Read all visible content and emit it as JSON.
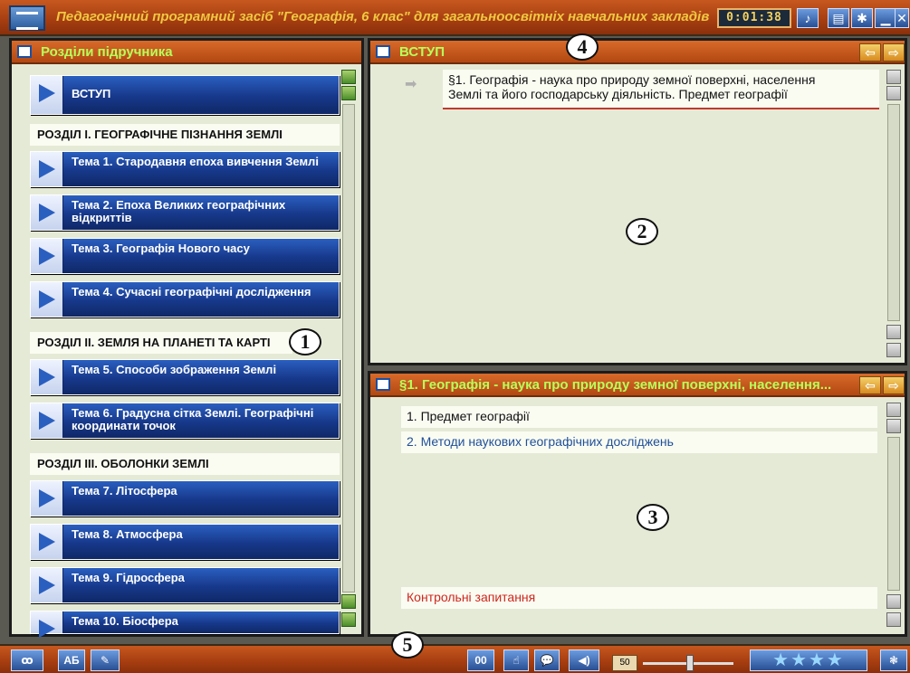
{
  "window": {
    "title": "Педагогічний програмний засіб \"Географія, 6 клас\" для загальноосвітніх навчальних закладів",
    "timer": "0:01:38"
  },
  "left_panel": {
    "title": "Розділи підручника",
    "intro_button": "ВСТУП",
    "section1": "РОЗДІЛ І. ГЕОГРАФІЧНЕ ПІЗНАННЯ ЗЕМЛІ",
    "topics1": [
      "Тема 1. Стародавня епоха вивчення Землі",
      "Тема 2. Епоха Великих географічних відкриттів",
      "Тема 3. Географія Нового часу",
      "Тема 4. Сучасні географічні дослідження"
    ],
    "section2": "РОЗДІЛ ІІ. ЗЕМЛЯ НА ПЛАНЕТІ ТА КАРТІ",
    "topics2": [
      "Тема 5. Способи зображення Землі",
      "Тема 6. Градусна сітка Землі. Географічні координати точок"
    ],
    "section3": "РОЗДІЛ ІІІ. ОБОЛОНКИ ЗЕМЛІ",
    "topics3": [
      "Тема 7. Літосфера",
      "Тема 8. Атмосфера",
      "Тема 9. Гідросфера",
      "Тема 10. Біосфера"
    ]
  },
  "top_right_panel": {
    "title": "ВСТУП",
    "paragraph_line1": "§1. Географія - наука про природу земної поверхні, населення",
    "paragraph_line2": "Землі та його господарську діяльність. Предмет географії"
  },
  "bottom_right_panel": {
    "title": "§1. Географія - наука про природу земної поверхні, населення...",
    "items": [
      "1. Предмет географії",
      "2. Методи наукових географічних досліджень"
    ],
    "questions": "Контрольні запитання"
  },
  "markers": {
    "m1": "1",
    "m2": "2",
    "m3": "3",
    "m4": "4",
    "m5": "5"
  },
  "bottom_bar": {
    "btn_00": "00",
    "btn_ab": "АБ",
    "volume": "50"
  },
  "colors": {
    "frame": "#b24812",
    "header_text": "#b6ff5a",
    "topic_button": "#17388a",
    "panel_bg": "#e5ead6",
    "questions_text": "#d0261c",
    "item_blue": "#1f4f9a"
  }
}
